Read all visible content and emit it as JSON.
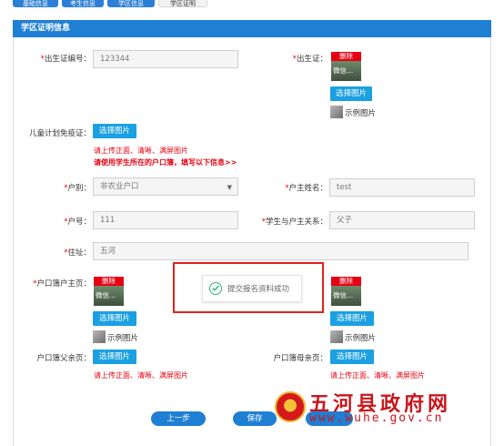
{
  "tabs": [
    {
      "label": "基础信息"
    },
    {
      "label": "考生信息"
    },
    {
      "label": "学区信息"
    },
    {
      "label": "学区证明"
    }
  ],
  "section": {
    "title": "学区证明信息"
  },
  "form": {
    "birth_cert_no": {
      "label": "出生证编号：",
      "value": "123344"
    },
    "birth_cert": {
      "label": "出生证：",
      "thumb_delete": "删除",
      "thumb_name": "微信...",
      "select_label": "选择图片",
      "sample_label": "示例图片"
    },
    "vaccine": {
      "label": "儿童计划免疫证：",
      "select_label": "选择图片"
    },
    "notes": {
      "upload_clear": "请上传正面、清晰、满屏图片",
      "use_household": "请使用学生所在的户口簿，填写以下信息>>"
    },
    "hukou_type": {
      "label": "户别：",
      "value": "非农业户口"
    },
    "householder_name": {
      "label": "户主姓名：",
      "value": "test"
    },
    "hukou_no": {
      "label": "户号：",
      "value": "111"
    },
    "relation": {
      "label": "学生与户主关系：",
      "value": "父子"
    },
    "address": {
      "label": "住址：",
      "value": "五河"
    },
    "hukou_main": {
      "label": "户口簿户主页：",
      "thumb_delete": "删除",
      "thumb_name": "微信...",
      "select_label": "选择图片",
      "sample_label": "示例图片"
    },
    "hukou_student": {
      "label_tail": "生页",
      "thumb_delete": "删除",
      "thumb_name": "微信...",
      "select_label": "选择图片",
      "sample_label": "示例图片"
    },
    "hukou_father": {
      "label": "户口簿父亲页：",
      "select_label": "选择图片",
      "note": "请上传正面、清晰、满屏图片"
    },
    "hukou_mother": {
      "label": "户口簿母亲页：",
      "select_label": "选择图片",
      "note": "请上传正面、清晰、满屏图片"
    }
  },
  "popup": {
    "message": "提交报名资料成功"
  },
  "actions": {
    "prev": "上一步",
    "save": "保存"
  },
  "watermark": {
    "title": "五河县政府网",
    "url": "www.wuhe.gov.cn"
  },
  "colors": {
    "accent": "#1f7fd3",
    "button": "#1ba0e2",
    "required": "#e60012",
    "success": "#2eb872",
    "watermark": "#c8161d"
  }
}
